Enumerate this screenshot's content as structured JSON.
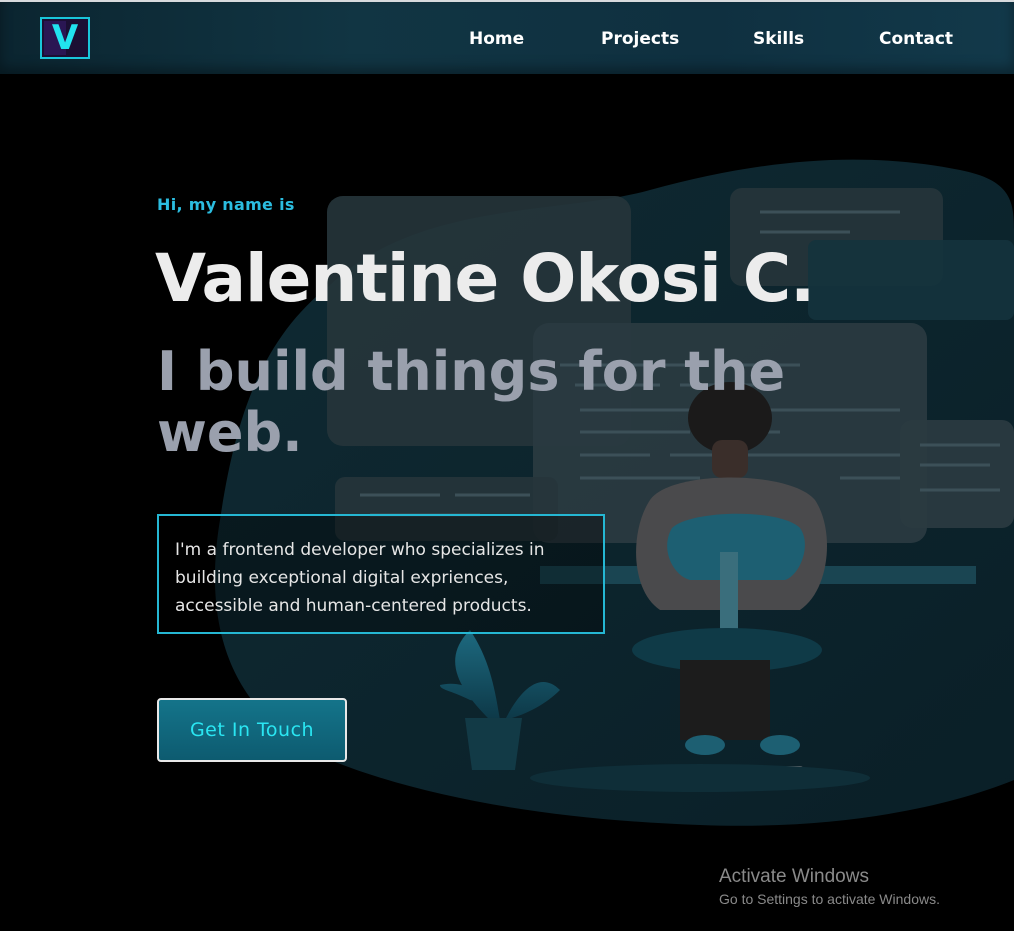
{
  "nav": {
    "logo_letter": "V",
    "links": [
      "Home",
      "Projects",
      "Skills",
      "Contact"
    ]
  },
  "hero": {
    "greeting": "Hi, my name is",
    "name": "Valentine Okosi C.",
    "tagline": "I build things for the web.",
    "bio": "I'm a frontend developer who specializes in building exceptional digital exprіences, accessible and human-centered products.",
    "cta_label": "Get In Touch"
  },
  "watermark": {
    "title": "Activate Windows",
    "subtitle": "Go to Settings to activate Windows."
  },
  "colors": {
    "accent": "#2bbde0",
    "cta_text": "#2ae6f2",
    "navbar": "#113543",
    "background": "#000000"
  },
  "icons": [
    "logo-icon",
    "developer-illustration"
  ]
}
